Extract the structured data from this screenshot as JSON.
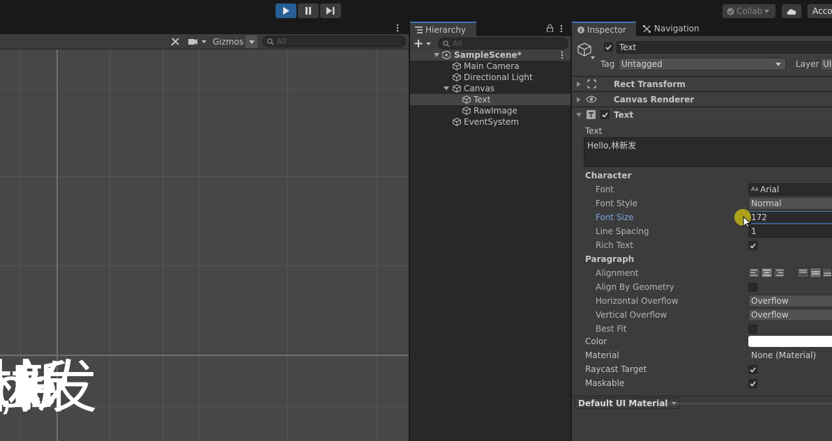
{
  "toolbar": {
    "collab_label": "Collab",
    "account_label": "Account"
  },
  "scene": {
    "gizmos_label": "Gizmos",
    "search_placeholder": "All",
    "overlay_text": "Hello,林新发"
  },
  "hierarchy": {
    "tab_label": "Hierarchy",
    "search_placeholder": "All",
    "items": [
      {
        "label": "SampleScene*",
        "indent": 0,
        "kind": "scene"
      },
      {
        "label": "Main Camera",
        "indent": 1,
        "kind": "object"
      },
      {
        "label": "Directional Light",
        "indent": 1,
        "kind": "object"
      },
      {
        "label": "Canvas",
        "indent": 1,
        "kind": "object",
        "expanded": true
      },
      {
        "label": "Text",
        "indent": 2,
        "kind": "object",
        "selected": true
      },
      {
        "label": "RawImage",
        "indent": 2,
        "kind": "object"
      },
      {
        "label": "EventSystem",
        "indent": 1,
        "kind": "object"
      }
    ]
  },
  "inspector": {
    "tabs": [
      {
        "label": "Inspector"
      },
      {
        "label": "Navigation"
      }
    ],
    "object_name": "Text",
    "tag_label": "Tag",
    "tag_value": "Untagged",
    "layer_label": "Layer",
    "layer_value": "UI",
    "components": [
      {
        "label": "Rect Transform"
      },
      {
        "label": "Canvas Renderer"
      },
      {
        "label": "Text"
      }
    ],
    "text_label": "Text",
    "text_value": "Hello,林新发",
    "character_header": "Character",
    "font_label": "Font",
    "font_value": "Arial",
    "font_style_label": "Font Style",
    "font_style_value": "Normal",
    "font_size_label": "Font Size",
    "font_size_value": "172",
    "line_spacing_label": "Line Spacing",
    "line_spacing_value": "1",
    "rich_text_label": "Rich Text",
    "paragraph_header": "Paragraph",
    "alignment_label": "Alignment",
    "align_geometry_label": "Align By Geometry",
    "h_overflow_label": "Horizontal Overflow",
    "h_overflow_value": "Overflow",
    "v_overflow_label": "Vertical Overflow",
    "v_overflow_value": "Overflow",
    "best_fit_label": "Best Fit",
    "color_label": "Color",
    "color_value": "#ffffff",
    "material_label": "Material",
    "material_value": "None (Material)",
    "raycast_label": "Raycast Target",
    "maskable_label": "Maskable",
    "default_material": "Default UI Material"
  }
}
